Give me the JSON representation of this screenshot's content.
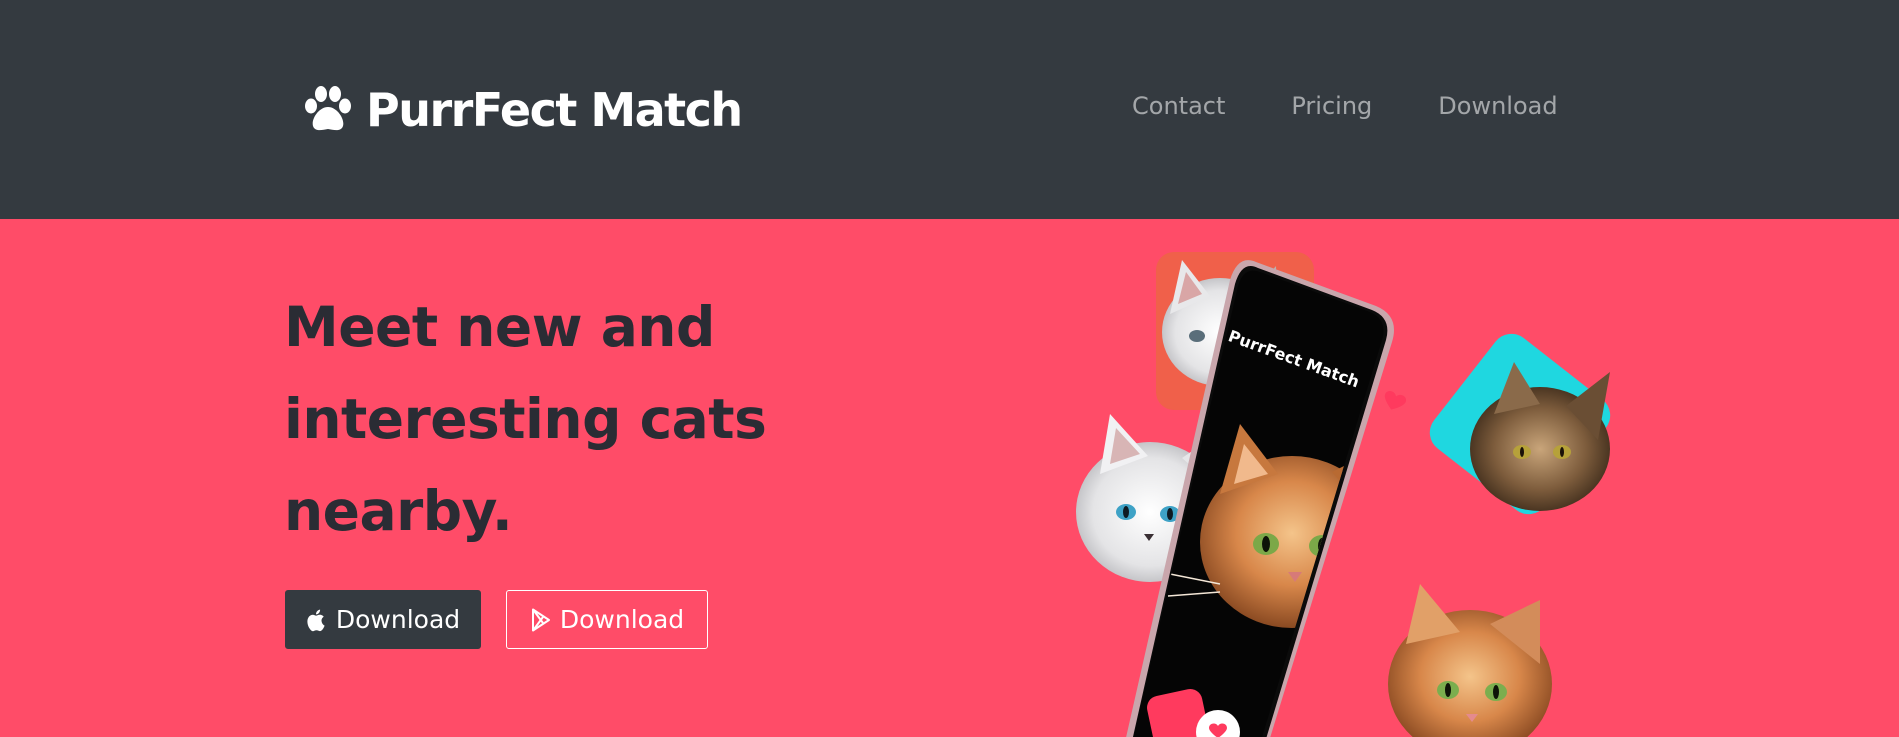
{
  "brand": {
    "name": "PurrFect Match",
    "icon": "paw-icon"
  },
  "nav": {
    "links": [
      "Contact",
      "Pricing",
      "Download"
    ]
  },
  "hero": {
    "headline_lines": [
      "Meet new and",
      "interesting cats",
      "nearby."
    ],
    "buttons": {
      "apple_label": "Download",
      "apple_icon": "apple-icon",
      "play_label": "Download",
      "play_icon": "google-play-icon"
    }
  },
  "phone": {
    "app_title": "PurrFect Match",
    "heart_icon": "heart-icon"
  },
  "colors": {
    "navbar_bg": "#343a40",
    "hero_bg": "#ff4c68",
    "headline": "#2a2c34",
    "nav_link": "rgba(255,255,255,0.55)"
  }
}
